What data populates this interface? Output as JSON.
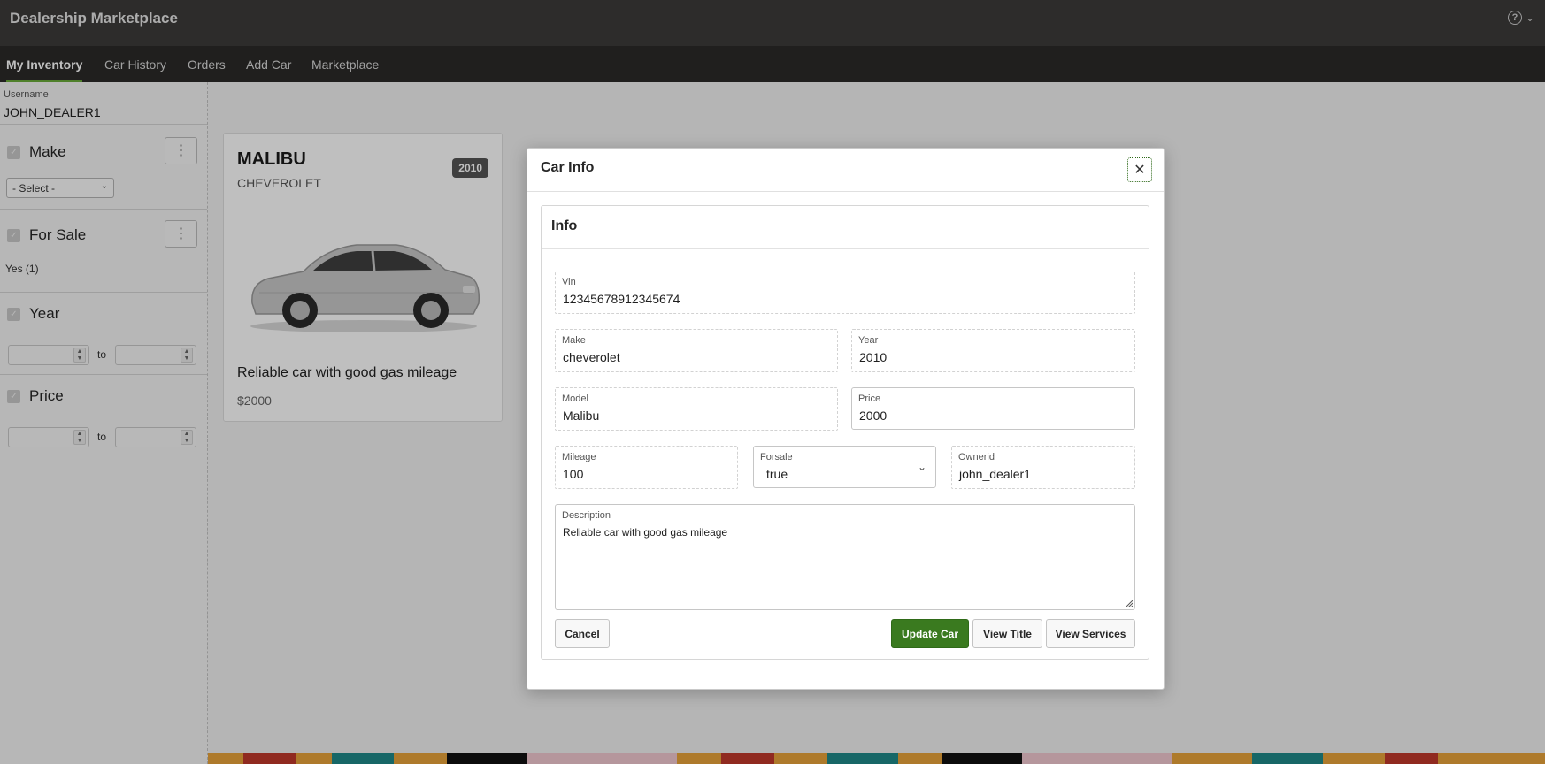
{
  "app": {
    "title": "Dealership Marketplace",
    "help_icon": "?"
  },
  "nav": {
    "tabs": [
      {
        "label": "My Inventory",
        "active": true
      },
      {
        "label": "Car History"
      },
      {
        "label": "Orders"
      },
      {
        "label": "Add Car"
      },
      {
        "label": "Marketplace"
      }
    ]
  },
  "sidebar": {
    "username_label": "Username",
    "username": "JOHN_DEALER1",
    "facets": {
      "make": {
        "title": "Make",
        "select_value": "- Select -"
      },
      "for_sale": {
        "title": "For Sale",
        "option": "Yes (1)"
      },
      "year": {
        "title": "Year",
        "to": "to"
      },
      "price": {
        "title": "Price",
        "to": "to"
      }
    }
  },
  "card": {
    "title": "MALIBU",
    "subtitle": "CHEVEROLET",
    "badge": "2010",
    "description": "Reliable car with good gas mileage",
    "price": "$2000"
  },
  "dialog": {
    "title": "Car Info",
    "region_title": "Info",
    "fields": {
      "vin": {
        "label": "Vin",
        "value": "12345678912345674"
      },
      "make": {
        "label": "Make",
        "value": "cheverolet"
      },
      "year": {
        "label": "Year",
        "value": "2010"
      },
      "model": {
        "label": "Model",
        "value": "Malibu"
      },
      "price": {
        "label": "Price",
        "value": "2000"
      },
      "mileage": {
        "label": "Mileage",
        "value": "100"
      },
      "forsale": {
        "label": "Forsale",
        "value": "true"
      },
      "ownerid": {
        "label": "Ownerid",
        "value": "john_dealer1"
      },
      "description": {
        "label": "Description",
        "value": "Reliable car with good gas mileage"
      }
    },
    "buttons": {
      "cancel": "Cancel",
      "update": "Update Car",
      "view_title": "View Title",
      "view_services": "View Services"
    }
  },
  "colors": {
    "header": "#3c3b3a",
    "nav": "#2b2a29",
    "accent": "#6aab3a",
    "primary_button": "#3a7a1f"
  }
}
